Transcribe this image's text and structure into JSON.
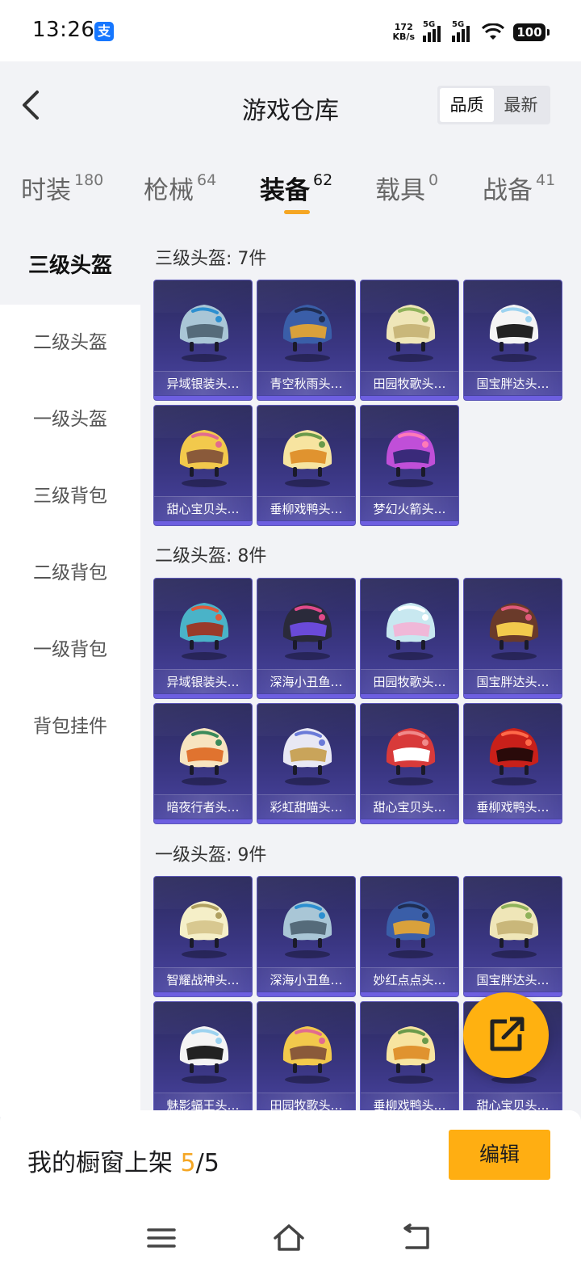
{
  "status_bar": {
    "time": "13:26",
    "alipay_glyph": "支",
    "net_speed_value": "172",
    "net_speed_unit": "KB/s",
    "signal1_label": "5G",
    "signal2_label": "5G",
    "battery": "100"
  },
  "header": {
    "title": "游戏仓库",
    "sort_options": [
      "品质",
      "最新"
    ]
  },
  "tabs": [
    {
      "label": "时装",
      "count": "180"
    },
    {
      "label": "枪械",
      "count": "64"
    },
    {
      "label": "装备",
      "count": "62"
    },
    {
      "label": "载具",
      "count": "0"
    },
    {
      "label": "战备",
      "count": "41"
    }
  ],
  "sidebar": {
    "items": [
      "三级头盔",
      "二级头盔",
      "一级头盔",
      "三级背包",
      "二级背包",
      "一级背包",
      "背包挂件"
    ]
  },
  "sections": [
    {
      "title": "三级头盔: 7件",
      "items": [
        "异域银装头…",
        "青空秋雨头…",
        "田园牧歌头…",
        "国宝胖达头…",
        "甜心宝贝头…",
        "垂柳戏鸭头…",
        "梦幻火箭头…"
      ]
    },
    {
      "title": "二级头盔: 8件",
      "items": [
        "异域银装头…",
        "深海小丑鱼…",
        "田园牧歌头…",
        "国宝胖达头…",
        "暗夜行者头…",
        "彩虹甜喵头…",
        "甜心宝贝头…",
        "垂柳戏鸭头…"
      ]
    },
    {
      "title": "一级头盔: 9件",
      "items": [
        "智耀战神头…",
        "深海小丑鱼…",
        "妙红点点头…",
        "国宝胖达头…",
        "魅影蝠王头…",
        "田园牧歌头…",
        "垂柳戏鸭头…",
        "甜心宝贝头…"
      ]
    }
  ],
  "bottom": {
    "showcase_prefix": "我的橱窗上架 ",
    "showcase_count": "5",
    "showcase_total": "/5",
    "edit_label": "编辑"
  },
  "colors": {
    "accent": "#f5a623",
    "card_bg": "#3a3682",
    "fab": "#ffb110"
  },
  "icons": {
    "back": "chevron-left-icon",
    "share": "share-external-icon",
    "nav": [
      "menu-icon",
      "home-icon",
      "back-icon"
    ]
  }
}
